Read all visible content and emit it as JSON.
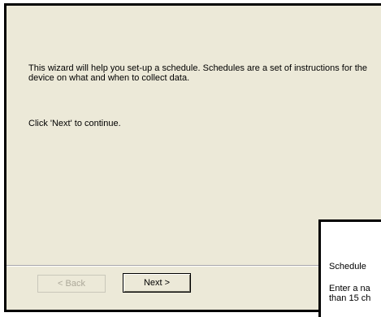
{
  "wizard": {
    "intro_text": "This wizard will help you set-up a schedule. Schedules are a set of instructions for the device on what and when to collect data.",
    "continue_text": "Click 'Next' to continue.",
    "back_label": "< Back",
    "next_label": "Next >"
  },
  "overlay": {
    "label": "Schedule",
    "description_line1": "Enter a na",
    "description_line2": "than 15 ch"
  }
}
